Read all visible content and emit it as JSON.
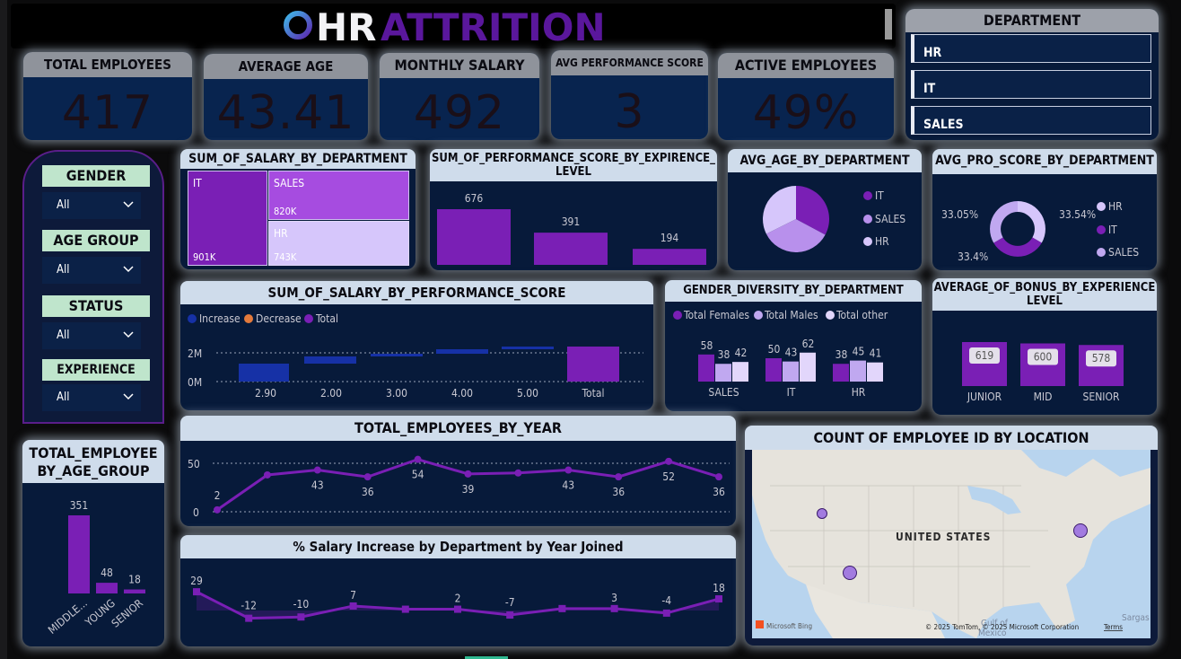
{
  "title": {
    "prefix": "HR",
    "accent": "ATTRITION"
  },
  "kpis": [
    {
      "label": "TOTAL EMPLOYEES",
      "value": "417"
    },
    {
      "label": "AVERAGE AGE",
      "value": "43.41"
    },
    {
      "label": "MONTHLY SALARY",
      "value": "492"
    },
    {
      "label": "AVG PERFORMANCE SCORE",
      "value": "3"
    },
    {
      "label": "ACTIVE EMPLOYEES",
      "value": "49%"
    }
  ],
  "department_slicer": {
    "title": "DEPARTMENT",
    "items": [
      "HR",
      "IT",
      "SALES"
    ]
  },
  "filters": [
    {
      "label": "GENDER",
      "value": "All"
    },
    {
      "label": "AGE GROUP",
      "value": "All"
    },
    {
      "label": "STATUS",
      "value": "All"
    },
    {
      "label": "EXPERIENCE",
      "value": "All"
    }
  ],
  "titles": {
    "salary_by_dept": "SUM_OF_SALARY_BY_DEPARTMENT",
    "perf_by_exp_1": "SUM_OF_PERFORMANCE_SCORE_BY_EXPIRENCE_",
    "perf_by_exp_2": "LEVEL",
    "age_by_dept": "AVG_AGE_BY_DEPARTMENT",
    "pro_by_dept": "AVG_PRO_SCORE_BY_DEPARTMENT",
    "salary_by_perf": "SUM_OF_SALARY_BY_PERFORMANCE_SCORE",
    "gender_div": "GENDER_DIVERSITY_BY_DEPARTMENT",
    "bonus_1": "AVERAGE_OF_BONUS_BY_EXPERIENCE",
    "bonus_2": "LEVEL",
    "emp_by_year": "TOTAL_EMPLOYEES_BY_YEAR",
    "emp_by_age_1": "TOTAL_EMPLOYEE",
    "emp_by_age_2": "BY_AGE_GROUP",
    "salary_increase": "% Salary Increase by Department by Year Joined",
    "map": "COUNT OF EMPLOYEE ID BY LOCATION"
  },
  "map": {
    "country": "UNITED STATES",
    "attribution": "© 2025 TomTom, © 2025 Microsoft Corporation",
    "terms": "Terms",
    "brand": "Microsoft Bing",
    "gulf1": "Gulf of",
    "gulf2": "Mexico",
    "sargasso": "Sargas"
  },
  "colors": {
    "purple": "#7a1fb5",
    "lilac": "#a64ce0",
    "pale": "#d6c6fb",
    "mid": "#b890ec",
    "blue": "#1631a6",
    "orange": "#e37a3c",
    "bg": "#071a3a"
  },
  "chart_data": [
    {
      "type": "treemap",
      "title": "SUM_OF_SALARY_BY_DEPARTMENT",
      "categories": [
        "IT",
        "SALES",
        "HR"
      ],
      "values": [
        901,
        820,
        743
      ],
      "labels": [
        "901K",
        "820K",
        "743K"
      ]
    },
    {
      "type": "bar",
      "title": "SUM_OF_PERFORMANCE_SCORE_BY_EXPIRENCE_LEVEL",
      "values": [
        676,
        391,
        194
      ]
    },
    {
      "type": "pie",
      "title": "AVG_AGE_BY_DEPARTMENT",
      "legend": [
        "IT",
        "SALES",
        "HR"
      ],
      "values": [
        33.6,
        33.2,
        33.2
      ]
    },
    {
      "type": "pie",
      "title": "AVG_PRO_SCORE_BY_DEPARTMENT",
      "legend": [
        "HR",
        "IT",
        "SALES"
      ],
      "values": [
        33.54,
        33.05,
        33.4
      ],
      "labels": [
        "33.54%",
        "33.05%",
        "33.4%"
      ]
    },
    {
      "type": "waterfall",
      "title": "SUM_OF_SALARY_BY_PERFORMANCE_SCORE",
      "legend": [
        "Increase",
        "Decrease",
        "Total"
      ],
      "categories": [
        "2.90",
        "2.00",
        "3.00",
        "4.00",
        "5.00",
        "Total"
      ],
      "ytick_labels": [
        "0M",
        "2M"
      ]
    },
    {
      "type": "bar",
      "title": "GENDER_DIVERSITY_BY_DEPARTMENT",
      "legend": [
        "Total Females",
        "Total Males",
        "Total other"
      ],
      "categories": [
        "SALES",
        "IT",
        "HR"
      ],
      "series": [
        {
          "name": "Total Females",
          "values": [
            58,
            50,
            38
          ]
        },
        {
          "name": "Total Males",
          "values": [
            38,
            43,
            45
          ]
        },
        {
          "name": "Total other",
          "values": [
            42,
            62,
            41
          ]
        }
      ]
    },
    {
      "type": "bar",
      "title": "AVERAGE_OF_BONUS_BY_EXPERIENCE LEVEL",
      "categories": [
        "JUNIOR",
        "MID",
        "SENIOR"
      ],
      "values": [
        619,
        600,
        578
      ]
    },
    {
      "type": "line",
      "title": "TOTAL_EMPLOYEES_BY_YEAR",
      "values": [
        2,
        38,
        43,
        36,
        54,
        39,
        40,
        43,
        36,
        52,
        36
      ],
      "labels": [
        "2",
        "",
        "43",
        "36",
        "54",
        "39",
        "",
        "43",
        "36",
        "52",
        "36"
      ],
      "ylim": [
        0,
        60
      ],
      "yticks": [
        0,
        50
      ]
    },
    {
      "type": "bar",
      "title": "TOTAL_EMPLOYEE BY_AGE_GROUP",
      "categories": [
        "MIDDLE...",
        "YOUNG",
        "SENIOR"
      ],
      "values": [
        351,
        48,
        18
      ]
    },
    {
      "type": "line",
      "title": "% Salary Increase by Department by Year Joined",
      "values": [
        29,
        -12,
        -10,
        7,
        2,
        2,
        -7,
        3,
        3,
        -4,
        18
      ],
      "labels": [
        "29",
        "-12",
        "-10",
        "7",
        "",
        "2",
        "-7",
        "",
        "3",
        "-4",
        "18"
      ]
    },
    {
      "type": "map",
      "title": "COUNT OF EMPLOYEE ID BY LOCATION",
      "points": [
        {
          "lon": -122.4,
          "lat": 47.6,
          "r": 5
        },
        {
          "lon": -118.3,
          "lat": 34.0,
          "r": 7
        },
        {
          "lon": -71.1,
          "lat": 42.3,
          "r": 7
        }
      ]
    }
  ]
}
